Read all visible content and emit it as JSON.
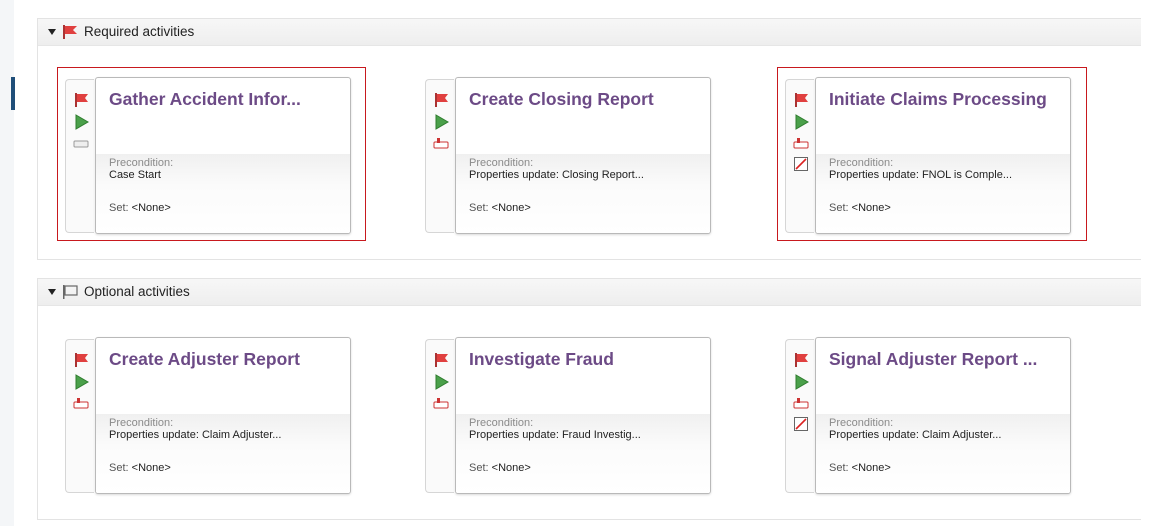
{
  "sections": [
    {
      "title": "Required activities",
      "cards": [
        {
          "title": "Gather Accident Infor...",
          "precondition_label": "Precondition:",
          "precondition": "Case Start",
          "set_label": "Set:",
          "set_value": "<None>"
        },
        {
          "title": "Create Closing Report",
          "precondition_label": "Precondition:",
          "precondition": "Properties update: Closing Report...",
          "set_label": "Set:",
          "set_value": "<None>"
        },
        {
          "title": "Initiate Claims Processing",
          "precondition_label": "Precondition:",
          "precondition": "Properties update: FNOL is Comple...",
          "set_label": "Set:",
          "set_value": "<None>"
        }
      ]
    },
    {
      "title": "Optional activities",
      "cards": [
        {
          "title": "Create Adjuster Report",
          "precondition_label": "Precondition:",
          "precondition": "Properties update: Claim Adjuster...",
          "set_label": "Set:",
          "set_value": "<None>"
        },
        {
          "title": "Investigate Fraud",
          "precondition_label": "Precondition:",
          "precondition": "Properties update: Fraud Investig...",
          "set_label": "Set:",
          "set_value": "<None>"
        },
        {
          "title": "Signal Adjuster Report ...",
          "precondition_label": "Precondition:",
          "precondition": "Properties update: Claim Adjuster...",
          "set_label": "Set:",
          "set_value": "<None>"
        }
      ]
    }
  ],
  "colors": {
    "title": "#6c4a86",
    "flag_red": "#e0403f",
    "play_green": "#4aa04a",
    "highlight": "#c8191e"
  }
}
